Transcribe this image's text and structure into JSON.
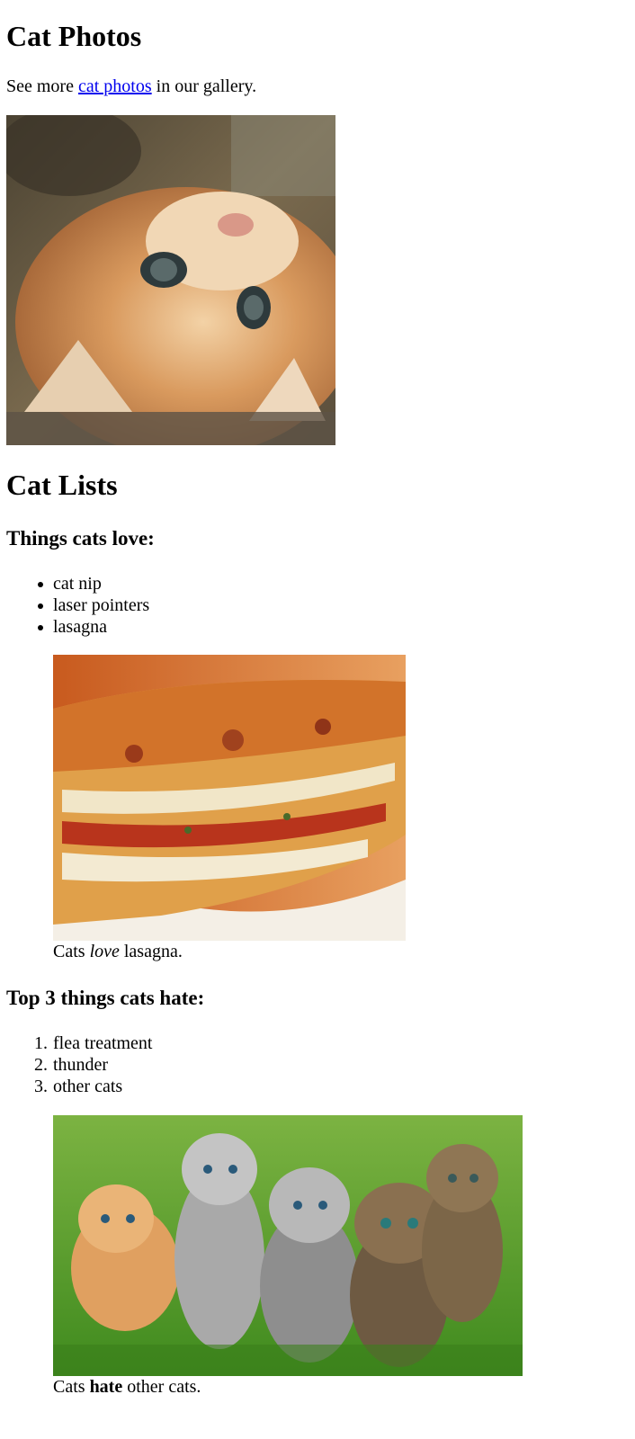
{
  "photos_section": {
    "heading": "Cat Photos",
    "intro_before": "See more ",
    "intro_link": "cat photos",
    "intro_after": " in our gallery."
  },
  "lists_section": {
    "heading": "Cat Lists",
    "love": {
      "heading": "Things cats love:",
      "items": [
        "cat nip",
        "laser pointers",
        "lasagna"
      ],
      "caption_before": "Cats ",
      "caption_emphasis": "love",
      "caption_after": " lasagna."
    },
    "hate": {
      "heading": "Top 3 things cats hate:",
      "markers": [
        "1.",
        "2.",
        "3."
      ],
      "items": [
        "flea treatment",
        "thunder",
        "other cats"
      ],
      "caption_before": "Cats ",
      "caption_strong": "hate",
      "caption_after": " other cats."
    }
  },
  "colors": {
    "link": "#0000ee",
    "text": "#000000",
    "background": "#ffffff"
  }
}
